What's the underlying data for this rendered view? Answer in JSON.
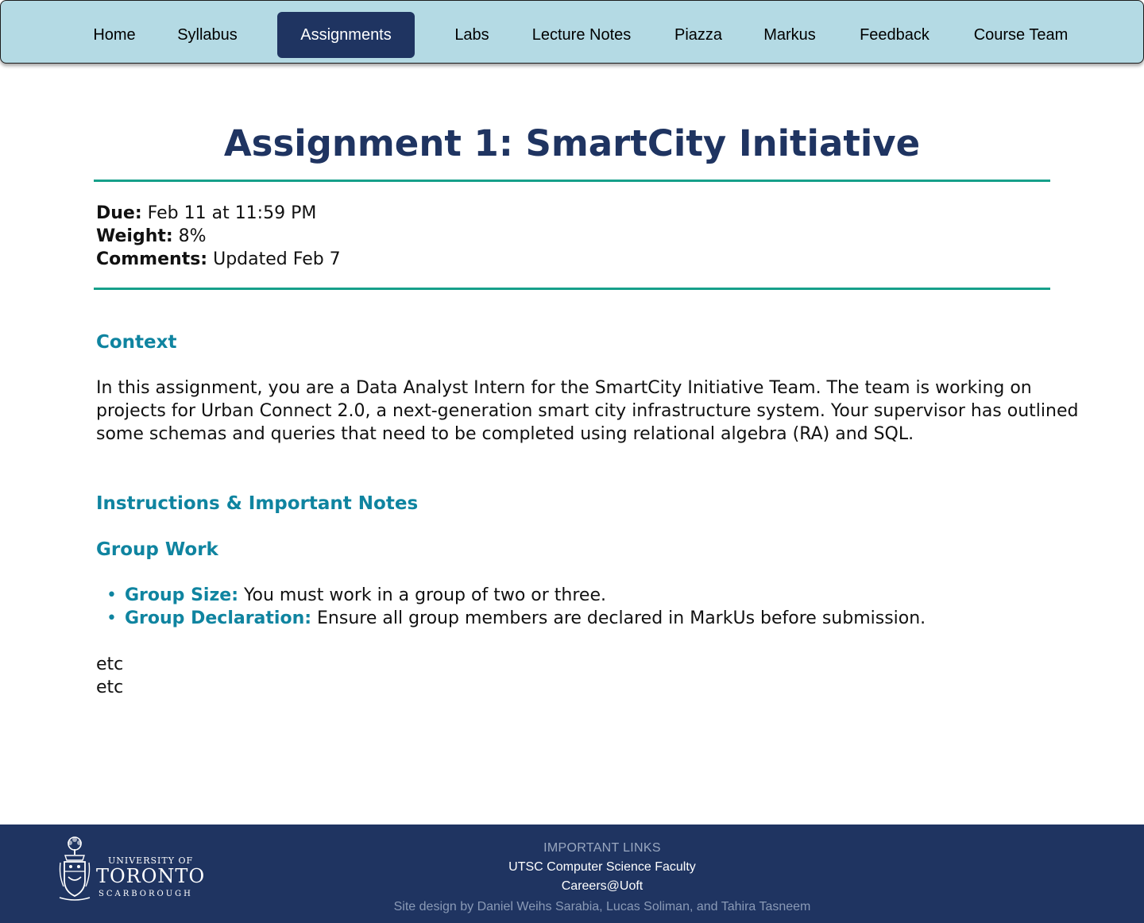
{
  "nav": {
    "items": [
      {
        "label": "Home",
        "active": false
      },
      {
        "label": "Syllabus",
        "active": false
      },
      {
        "label": "Assignments",
        "active": true
      },
      {
        "label": "Labs",
        "active": false
      },
      {
        "label": "Lecture Notes",
        "active": false
      },
      {
        "label": "Piazza",
        "active": false
      },
      {
        "label": "Markus",
        "active": false
      },
      {
        "label": "Feedback",
        "active": false
      },
      {
        "label": "Course Team",
        "active": false
      }
    ]
  },
  "assignment": {
    "title": "Assignment 1: SmartCity Initiative",
    "due_label": "Due:",
    "due_value": "Feb 11 at 11:59 PM",
    "weight_label": "Weight:",
    "weight_value": "8%",
    "comments_label": "Comments:",
    "comments_value": "Updated Feb 7"
  },
  "content": {
    "context_heading": "Context",
    "context_text": "In this assignment, you are a Data Analyst Intern for the SmartCity Initiative Team. The team is working on projects for Urban Connect 2.0, a next-generation smart city infrastructure system. Your supervisor has outlined some schemas and queries that need to be completed using relational algebra (RA) and SQL.",
    "instructions_heading": "Instructions & Important Notes",
    "group_work_heading": "Group Work",
    "bullets": [
      {
        "label": "Group Size:",
        "text": "You must work in a group of two or three."
      },
      {
        "label": "Group Declaration:",
        "text": "Ensure all group members are declared in MarkUs before submission."
      }
    ],
    "etc_1": "etc",
    "etc_2": "etc"
  },
  "footer": {
    "logo_line1": "UNIVERSITY OF",
    "logo_line2": "TORONTO",
    "logo_line3": "SCARBOROUGH",
    "links_heading": "IMPORTANT LINKS",
    "link_1": "UTSC Computer Science Faculty",
    "link_2": "Careers@Uoft",
    "credit": "Site design by Daniel Weihs Sarabia, Lucas Soliman, and Tahira Tasneem"
  },
  "colors": {
    "nav_bg": "#b4dae4",
    "nav_active": "#1f3461",
    "title": "#1f3461",
    "rule": "#16a08a",
    "heading": "#0f84a0",
    "footer_bg": "#1f3461"
  }
}
